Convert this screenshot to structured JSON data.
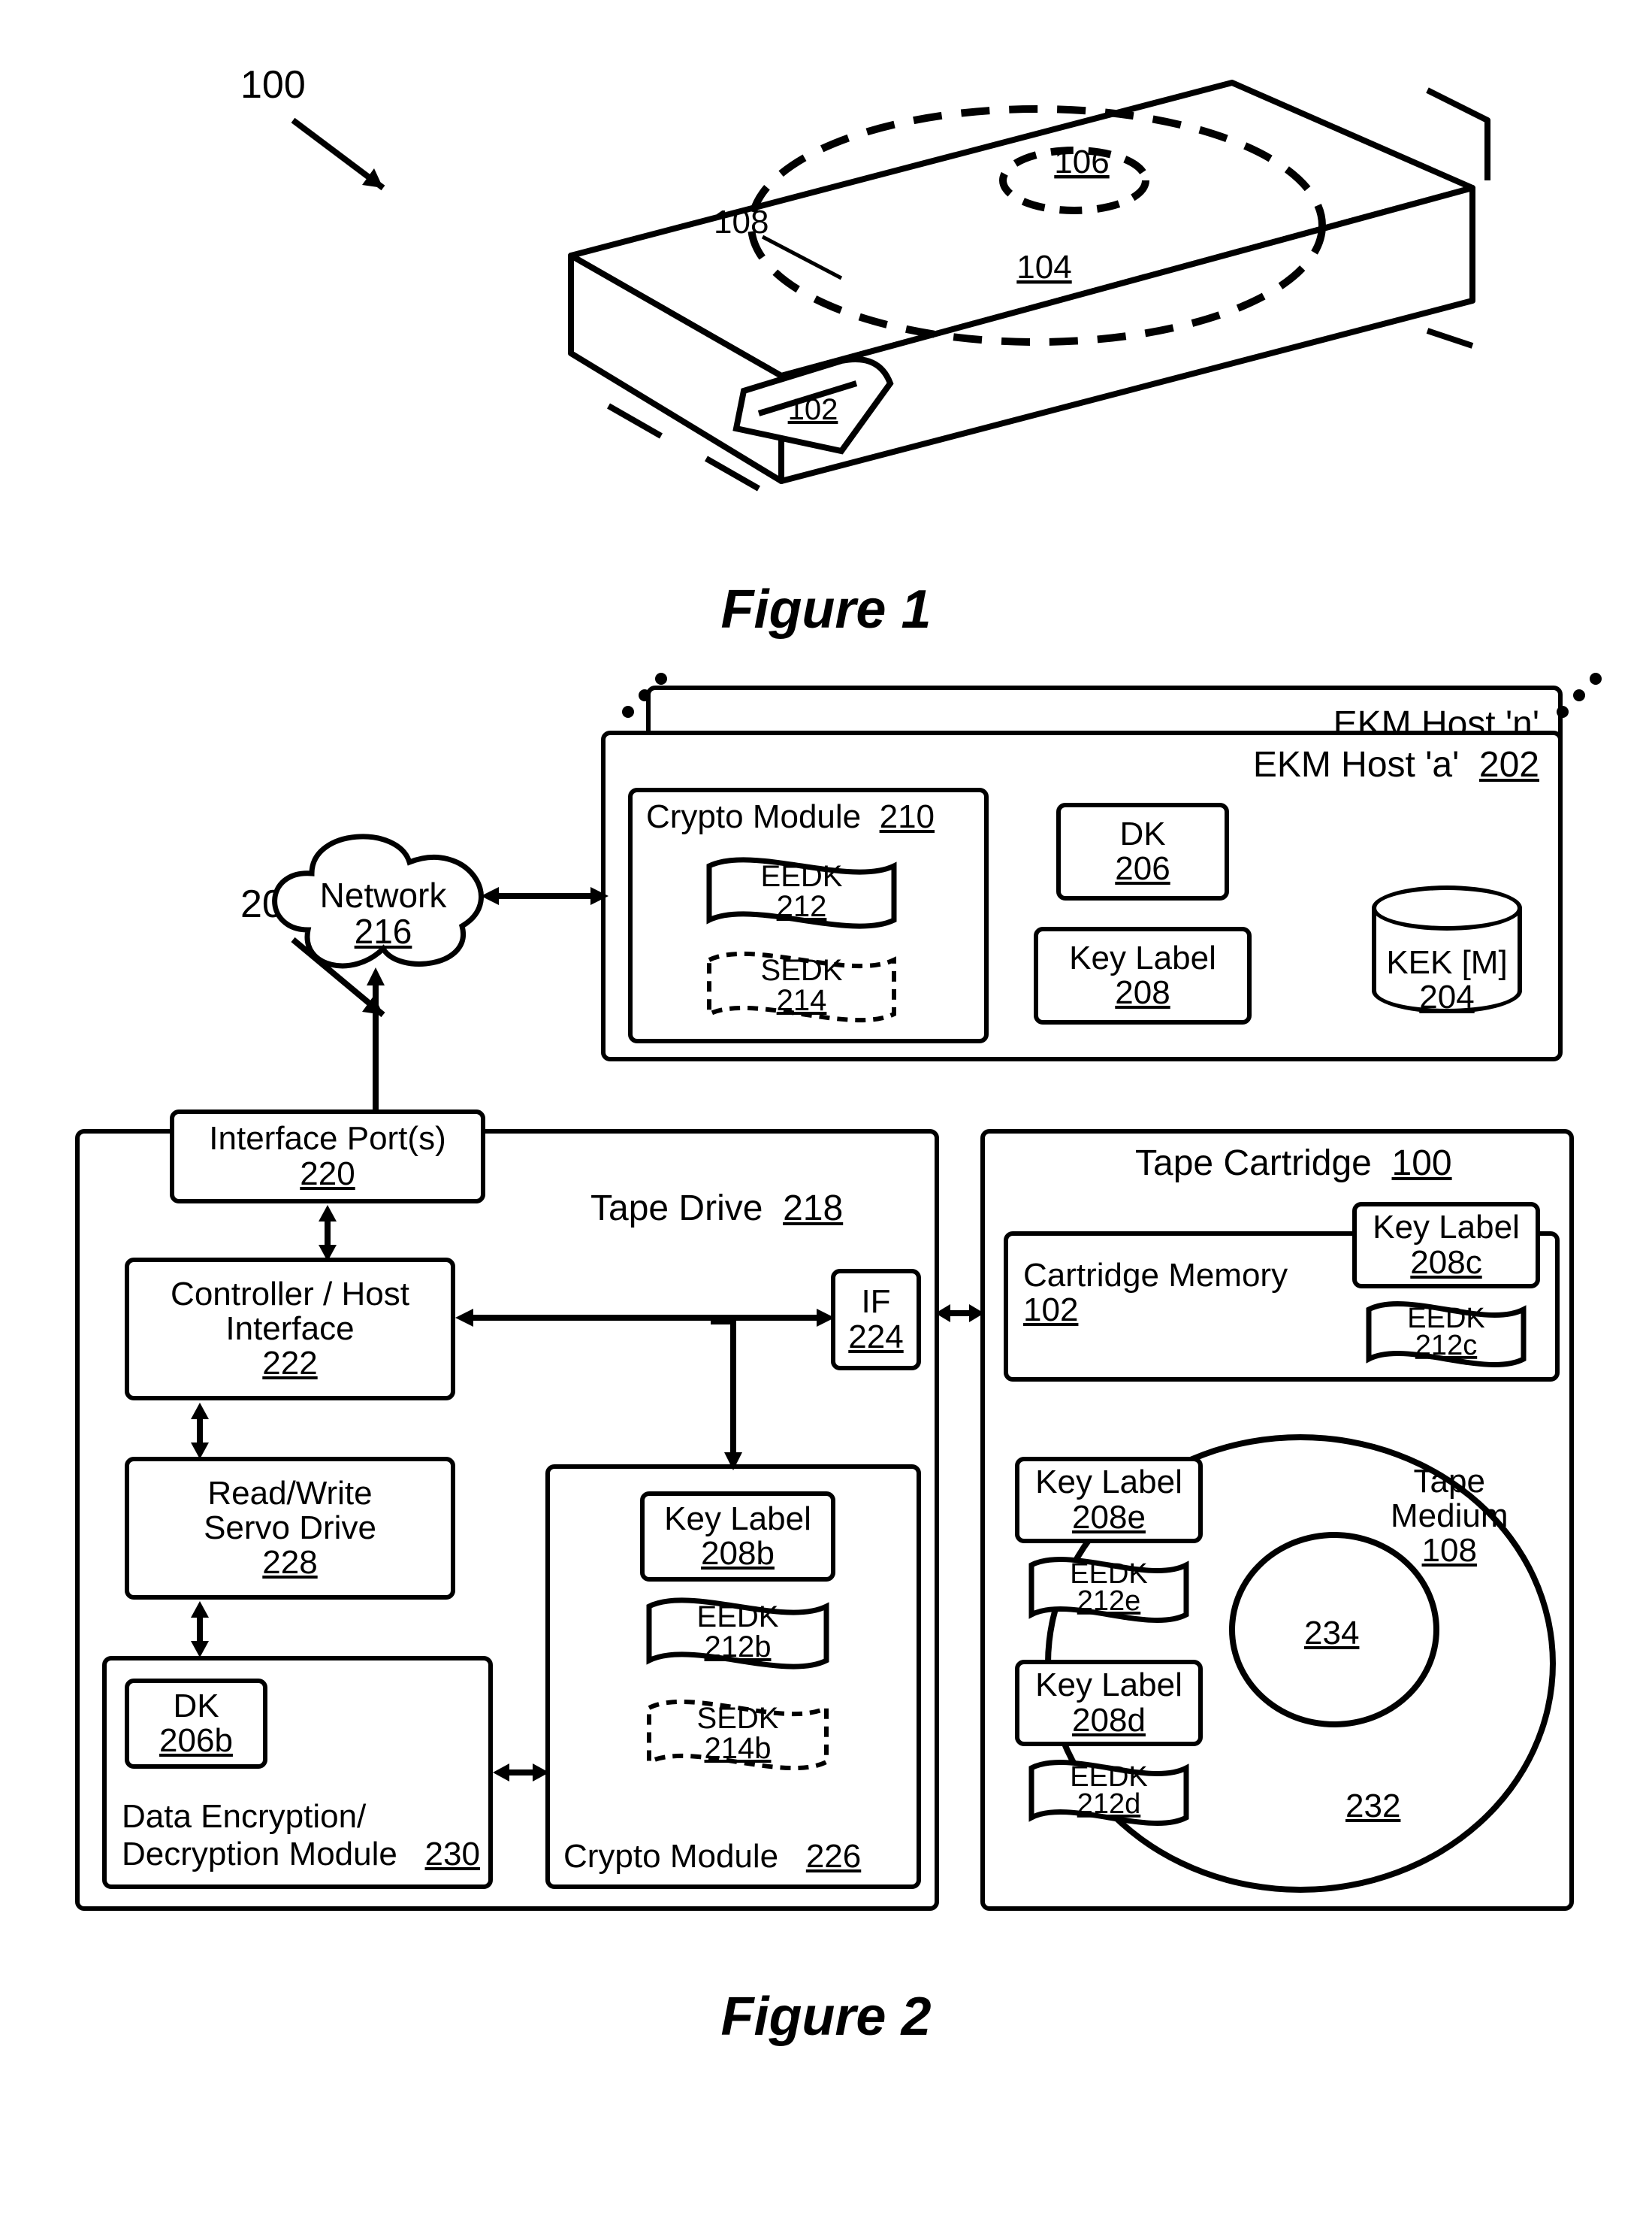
{
  "figure1": {
    "ref_arrow": "100",
    "caption": "Figure 1",
    "refs": {
      "cm": "102",
      "reel": "104",
      "hub": "106",
      "tape": "108"
    }
  },
  "figure2": {
    "ref_arrow": "200",
    "caption": "Figure 2",
    "network": {
      "label": "Network",
      "ref": "216"
    },
    "ekm_n": {
      "title": "EKM Host 'n'"
    },
    "ekm_a": {
      "title": "EKM Host 'a'",
      "ref": "202",
      "crypto": {
        "title": "Crypto Module",
        "ref": "210"
      },
      "eedk": {
        "label": "EEDK",
        "ref": "212"
      },
      "sedk": {
        "label": "SEDK",
        "ref": "214"
      },
      "dk": {
        "label": "DK",
        "ref": "206"
      },
      "keylabel": {
        "label": "Key Label",
        "ref": "208"
      },
      "kek": {
        "label": "KEK [M]",
        "ref": "204"
      }
    },
    "tape_drive": {
      "title": "Tape Drive",
      "ref": "218",
      "interface_ports": {
        "label": "Interface Port(s)",
        "ref": "220"
      },
      "controller": {
        "line1": "Controller / Host",
        "line2": "Interface",
        "ref": "222"
      },
      "if": {
        "label": "IF",
        "ref": "224"
      },
      "rw": {
        "line1": "Read/Write",
        "line2": "Servo Drive",
        "ref": "228"
      },
      "dedm": {
        "line1": "Data Encryption/",
        "line2": "Decryption Module",
        "ref": "230",
        "dk": {
          "label": "DK",
          "ref": "206b"
        }
      },
      "crypto": {
        "title": "Crypto Module",
        "ref": "226",
        "keylabel": {
          "label": "Key Label",
          "ref": "208b"
        },
        "eedk": {
          "label": "EEDK",
          "ref": "212b"
        },
        "sedk": {
          "label": "SEDK",
          "ref": "214b"
        }
      }
    },
    "cartridge": {
      "title": "Tape Cartridge",
      "ref": "100",
      "cm": {
        "label": "Cartridge Memory",
        "ref": "102"
      },
      "keylabel_c": {
        "label": "Key Label",
        "ref": "208c"
      },
      "eedk_c": {
        "label": "EEDK",
        "ref": "212c"
      },
      "medium": {
        "label1": "Tape",
        "label2": "Medium",
        "ref": "108"
      },
      "outer_ring_ref": "232",
      "inner_ring_ref": "234",
      "keylabel_e": {
        "label": "Key Label",
        "ref": "208e"
      },
      "eedk_e": {
        "label": "EEDK",
        "ref": "212e"
      },
      "keylabel_d": {
        "label": "Key Label",
        "ref": "208d"
      },
      "eedk_d": {
        "label": "EEDK",
        "ref": "212d"
      }
    }
  }
}
